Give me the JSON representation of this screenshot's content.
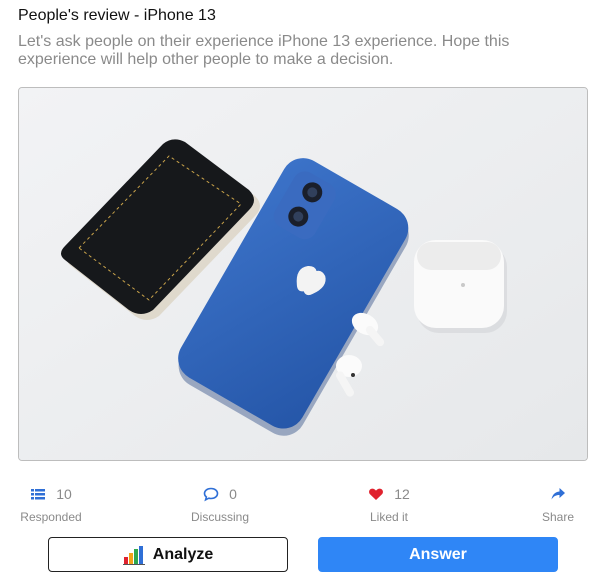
{
  "post": {
    "title": "People's review - iPhone 13",
    "description": "Let's ask people on their experience iPhone 13 experience. Hope this experience will help other people to make a decision."
  },
  "stats": [
    {
      "icon": "list-icon",
      "count": "10",
      "label": "Responded",
      "color": "#2f6fd6"
    },
    {
      "icon": "comment-icon",
      "count": "0",
      "label": "Discussing",
      "color": "#2f6fd6"
    },
    {
      "icon": "heart-icon",
      "count": "12",
      "label": "Liked it",
      "color": "#e0222e"
    },
    {
      "icon": "share-icon",
      "count": "",
      "label": "Share",
      "color": "#2f6fd6"
    }
  ],
  "actions": {
    "analyze_label": "Analyze",
    "analyze_icon": "bar-chart-icon",
    "answer_label": "Answer",
    "answer_color": "#2f86f6"
  }
}
